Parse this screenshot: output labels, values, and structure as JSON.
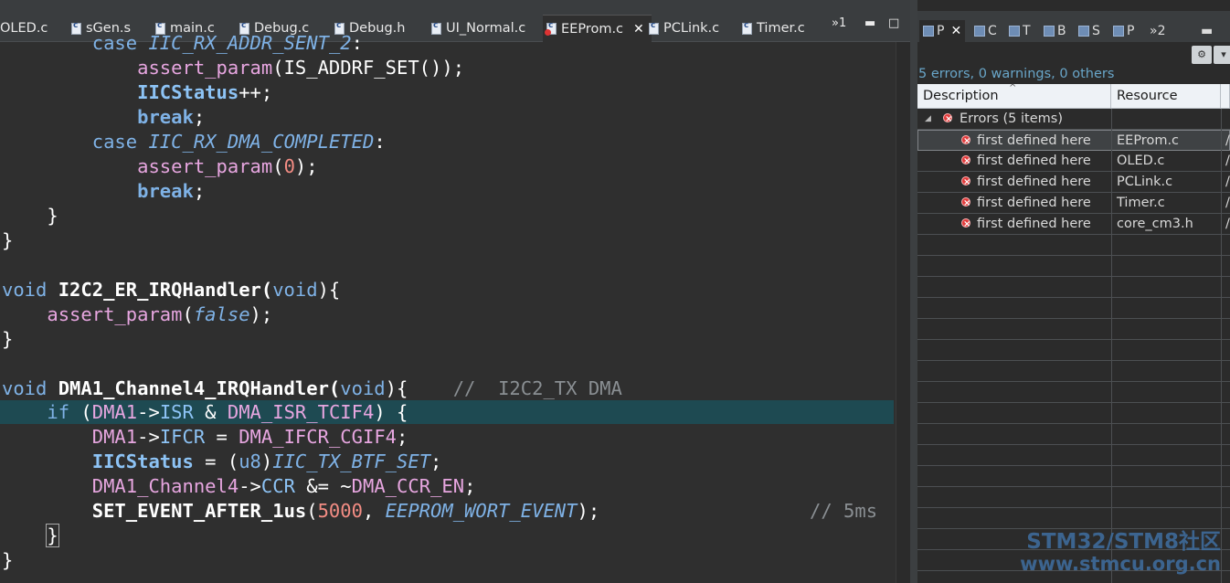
{
  "editor": {
    "tabs": [
      {
        "label": "OLED.c",
        "active": false
      },
      {
        "label": "sGen.s",
        "active": false
      },
      {
        "label": "main.c",
        "active": false
      },
      {
        "label": "Debug.c",
        "active": false
      },
      {
        "label": "Debug.h",
        "active": false
      },
      {
        "label": "UI_Normal.c",
        "active": false
      },
      {
        "label": "EEProm.c",
        "active": true
      },
      {
        "label": "PCLink.c",
        "active": false
      },
      {
        "label": "Timer.c",
        "active": false
      }
    ],
    "close_glyph": "✕",
    "overflow_label": "»1",
    "minimize_glyph": "▬",
    "maximize_glyph": "□",
    "code": {
      "l1_case": "case ",
      "l1_macro": "IIC_RX_ADDR_SENT_2",
      "l1_colon": ":",
      "l2_fn": "assert_param",
      "l2_rest": "(IS_ADDRF_SET());",
      "l3_id": "IICStatus",
      "l3_rest": "++;",
      "l4_break": "break",
      "l4_semi": ";",
      "l5_case": "case ",
      "l5_macro": "IIC_RX_DMA_COMPLETED",
      "l5_colon": ":",
      "l6_fn": "assert_param",
      "l6_open": "(",
      "l6_num": "0",
      "l6_close": ");",
      "l7_break": "break",
      "l7_semi": ";",
      "l8_brace": "}",
      "l9_brace": "}",
      "l10_void": "void",
      "l10_name": " I2C2_ER_IRQHandler(",
      "l10_void2": "void",
      "l10_end": "){",
      "l11_fn": "assert_param",
      "l11_open": "(",
      "l11_false": "false",
      "l11_close": ");",
      "l12_brace": "}",
      "l13_void": "void",
      "l13_name": " DMA1_Channel4_IRQHandler(",
      "l13_void2": "void",
      "l13_end": "){    ",
      "l13_cmt": "//  I2C2_TX DMA",
      "l14_if": "if",
      "l14_open": " (",
      "l14_dma": "DMA1",
      "l14_arrow": "->",
      "l14_isr": "ISR",
      "l14_and": " & ",
      "l14_flag": "DMA_ISR_TCIF4",
      "l14_end": ") {",
      "l15_dma": "DMA1",
      "l15_arrow": "->",
      "l15_ifcr": "IFCR",
      "l15_eq": " = ",
      "l15_flag": "DMA_IFCR_CGIF4",
      "l15_semi": ";",
      "l16_id": "IICStatus",
      "l16_eq": " = (",
      "l16_type": "u8",
      "l16_close": ")",
      "l16_macro": "IIC_TX_BTF_SET",
      "l16_semi": ";",
      "l17_ch": "DMA1_Channel4",
      "l17_arrow": "->",
      "l17_ccr": "CCR",
      "l17_op": " &= ~",
      "l17_flag": "DMA_CCR_EN",
      "l17_semi": ";",
      "l18_fn": "SET_EVENT_AFTER_1us",
      "l18_open": "(",
      "l18_num": "5000",
      "l18_comma": ", ",
      "l18_macro": "EEPROM_WORT_EVENT",
      "l18_close": ");",
      "l18_cmt": "// 5ms",
      "l19_brace": "}",
      "l20_brace": "}"
    }
  },
  "problems_view": {
    "tabs": [
      {
        "label": "P",
        "active": true
      },
      {
        "label": "C",
        "active": false
      },
      {
        "label": "T",
        "active": false
      },
      {
        "label": "B",
        "active": false
      },
      {
        "label": "S",
        "active": false
      },
      {
        "label": "P",
        "active": false
      }
    ],
    "overflow_label": "»2",
    "summary": "5 errors, 0 warnings, 0 others",
    "columns": [
      "Description",
      "Resource",
      "/"
    ],
    "group_label": "Errors (5 items)",
    "rows": [
      {
        "description": "first defined here",
        "resource": "EEProm.c",
        "path": "/",
        "selected": true
      },
      {
        "description": "first defined here",
        "resource": "OLED.c",
        "path": "/",
        "selected": false
      },
      {
        "description": "first defined here",
        "resource": "PCLink.c",
        "path": "/",
        "selected": false
      },
      {
        "description": "first defined here",
        "resource": "Timer.c",
        "path": "/",
        "selected": false
      },
      {
        "description": "first defined here",
        "resource": "core_cm3.h",
        "path": "/",
        "selected": false
      }
    ]
  },
  "watermark": {
    "line1": "STM32/STM8社区",
    "line2": "www.stmcu.org.cn"
  },
  "colors": {
    "editor_bg": "#2f2f2f",
    "line_highlight": "#1e4a52",
    "keyword": "#7fb2e6",
    "function": "#e7a6e0",
    "number": "#f48d84",
    "error_red": "#e23c3c",
    "summary_text": "#69a6c9"
  }
}
